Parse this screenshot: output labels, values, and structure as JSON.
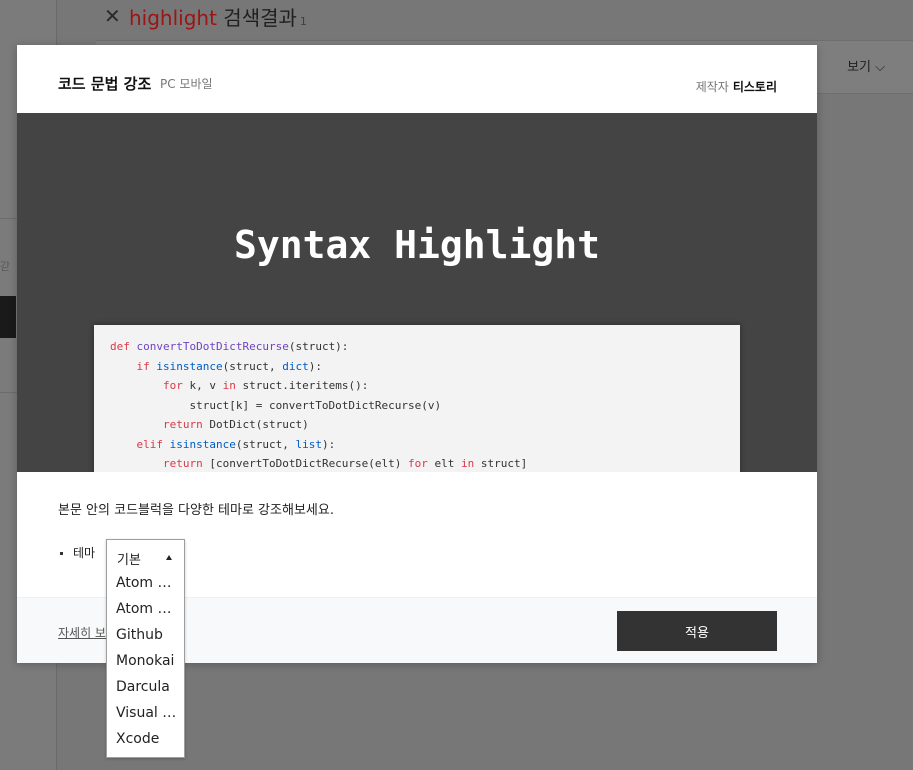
{
  "background": {
    "search_keyword": "highlight",
    "search_title_suffix": "검색결과",
    "result_count": "1",
    "view_label": "보기",
    "left_glyph": "갇"
  },
  "modal": {
    "title": "코드 문법 강조",
    "platforms": "PC 모바일",
    "maker_label": "제작자",
    "maker_name": "티스토리",
    "preview_title": "Syntax Highlight",
    "code_lines": [
      "def convertToDotDictRecurse(struct):",
      "    if isinstance(struct, dict):",
      "        for k, v in struct.iteritems():",
      "            struct[k] = convertToDotDictRecurse(v)",
      "        return DotDict(struct)",
      "    elif isinstance(struct, list):",
      "        return [convertToDotDictRecurse(elt) for elt in struct]"
    ],
    "description": "본문 안의 코드블럭을 다양한 테마로 강조해보세요.",
    "theme_label": "테마",
    "detail_link": "자세히 보기",
    "apply_label": "적용"
  },
  "theme_select": {
    "selected": "기본",
    "options": [
      "Atom One Dark",
      "Atom One Light",
      "Github",
      "Monokai",
      "Darcula",
      "Visual Studio",
      "Xcode"
    ]
  }
}
